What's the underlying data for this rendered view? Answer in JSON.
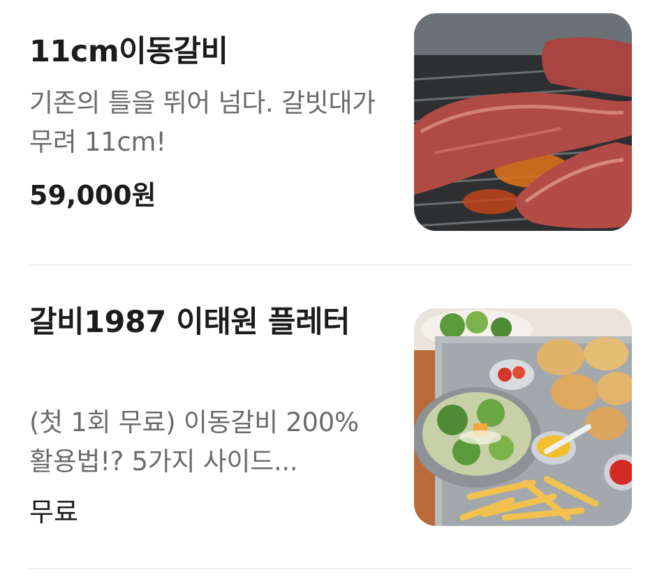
{
  "menu_items": [
    {
      "title": "11cm이동갈비",
      "description": "기존의 틀을 뛰어 넘다. 갈빗대가 무려 11cm!",
      "price": "59,000원",
      "image_icon": "grilled-galbi-photo"
    },
    {
      "title": "갈비1987 이태원 플레터",
      "description": "(첫 1회 무료) 이동갈비 200% 활용법!? 5가지 사이드...",
      "price": "무료",
      "image_icon": "platter-side-dishes-photo"
    }
  ]
}
